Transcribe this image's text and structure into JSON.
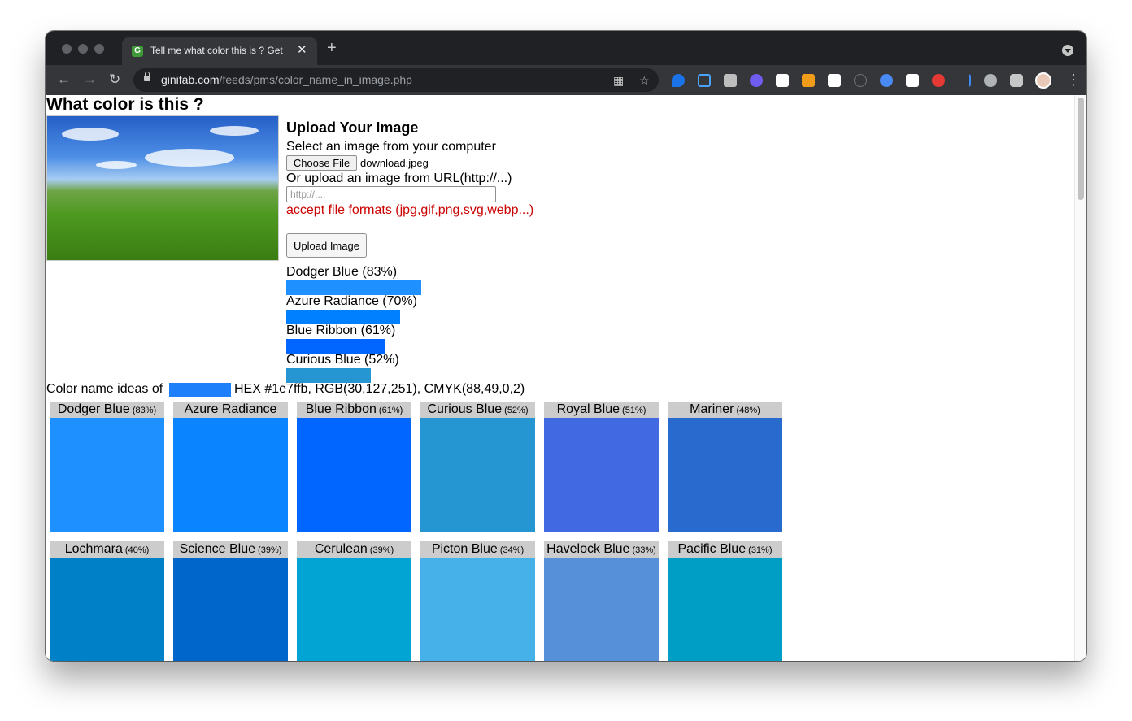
{
  "browser": {
    "tab_title": "Tell me what color this is ? Get",
    "tab_favicon": "G",
    "url_host": "ginifab.com",
    "url_path": "/feeds/pms/color_name_in_image.php"
  },
  "page": {
    "title": "What color is this ?",
    "upload": {
      "heading": "Upload Your Image",
      "select_label": "Select an image from your computer",
      "choose_button": "Choose File",
      "file_name": "download.jpeg",
      "url_label": "Or upload an image from URL(http://...)",
      "url_placeholder": "http://....",
      "formats_note": "accept file formats (jpg,gif,png,svg,webp...)",
      "upload_button": "Upload Image"
    },
    "top_results": [
      {
        "label": "Dodger Blue (83%)",
        "fraction": 0.83,
        "color": "#1e90ff"
      },
      {
        "label": "Azure Radiance (70%)",
        "fraction": 0.7,
        "color": "#007fff"
      },
      {
        "label": "Blue Ribbon (61%)",
        "fraction": 0.61,
        "color": "#0066ff"
      },
      {
        "label": "Curious Blue (52%)",
        "fraction": 0.52,
        "color": "#2596d1"
      }
    ],
    "ideas": {
      "prefix": "Color name ideas of",
      "swatch_color": "#1e7ffb",
      "codes": "HEX #1e7ffb, RGB(30,127,251), CMYK(88,49,0,2)"
    },
    "color_cards": [
      {
        "name": "Dodger Blue",
        "pct": "(83%)",
        "color": "#1e90ff"
      },
      {
        "name": "Azure Radiance",
        "pct": "",
        "color": "#0a85ff"
      },
      {
        "name": "Blue Ribbon",
        "pct": "(61%)",
        "color": "#0066ff"
      },
      {
        "name": "Curious Blue",
        "pct": "(52%)",
        "color": "#2596d1"
      },
      {
        "name": "Royal Blue",
        "pct": "(51%)",
        "color": "#4169e1"
      },
      {
        "name": "Mariner",
        "pct": "(48%)",
        "color": "#286acd"
      },
      {
        "name": "Lochmara",
        "pct": "(40%)",
        "color": "#0080c6"
      },
      {
        "name": "Science Blue",
        "pct": "(39%)",
        "color": "#0066cc"
      },
      {
        "name": "Cerulean",
        "pct": "(39%)",
        "color": "#02a4d3"
      },
      {
        "name": "Picton Blue",
        "pct": "(34%)",
        "color": "#45b1e8"
      },
      {
        "name": "Havelock Blue",
        "pct": "(33%)",
        "color": "#5590d9"
      },
      {
        "name": "Pacific Blue",
        "pct": "(31%)",
        "color": "#009dc4"
      }
    ]
  }
}
